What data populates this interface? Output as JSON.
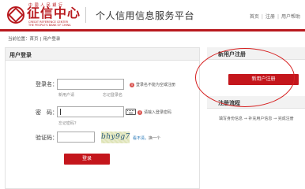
{
  "header": {
    "logo_top": "中 國 人 民 銀 行",
    "logo_name": "征信中心",
    "logo_en_line1": "CREDIT REFERENCE CENTER",
    "logo_en_line2": "THE PEOPLE'S BANK OF CHINA",
    "site_title": "个人信用信息服务平台",
    "links": {
      "home": "首页",
      "login": "注册",
      "help": "用户帮助"
    }
  },
  "breadcrumb": {
    "prefix": "当前位置：",
    "home": "首页",
    "current": "用户登录"
  },
  "login": {
    "title": "用户登录",
    "username_label": "登录名：",
    "username_value": "",
    "username_hint_left": "新用户请",
    "username_hint_right": "忘记登录名",
    "username_note": "登录名不能为空或注册",
    "password_label": "密　码：",
    "password_value": "",
    "password_note": "请输入登录密码",
    "forgot_password": "忘记密码？",
    "captcha_label": "验证码：",
    "captcha_value": "",
    "captcha_text": "bhy9g7",
    "refresh_q": "看不清，",
    "refresh_action": "换一个",
    "submit_label": "登录"
  },
  "register": {
    "new_user_title": "新用户注册",
    "new_user_button": "新用户注册",
    "flow_title": "注册流程",
    "flow_steps": "填写身份信息 → 补充用户信息 → 完成注册"
  },
  "colors": {
    "brand": "#b8191e",
    "button": "#c4161c",
    "annotation": "#d62020"
  }
}
